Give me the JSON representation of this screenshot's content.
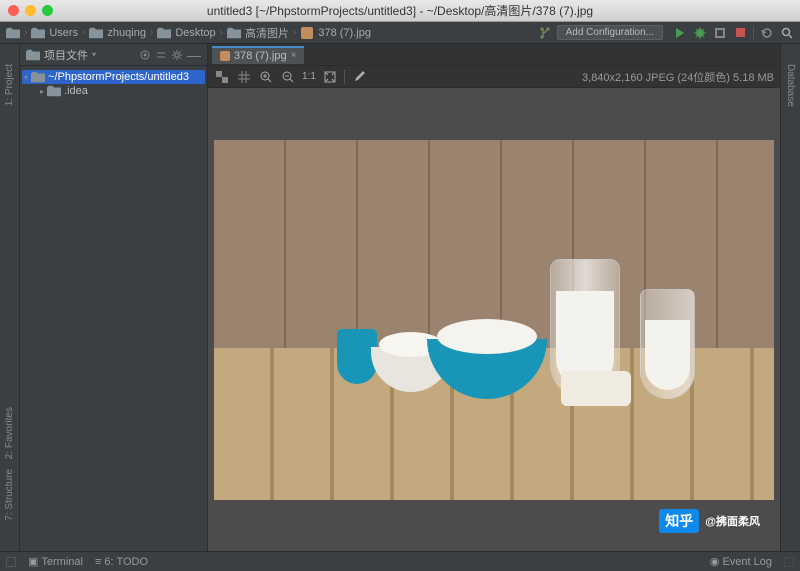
{
  "title": "untitled3 [~/PhpstormProjects/untitled3] - ~/Desktop/高清图片/378 (7).jpg",
  "breadcrumbs": [
    "Users",
    "zhuqing",
    "Desktop",
    "高清图片",
    "378 (7).jpg"
  ],
  "add_config_label": "Add Configuration...",
  "sidebar": {
    "title": "项目文件",
    "root": "~/PhpstormProjects/untitled3",
    "items": [
      ".idea"
    ]
  },
  "tabs": [
    {
      "label": "378 (7).jpg",
      "active": true
    }
  ],
  "image_toolbar": {
    "fit_label": "1:1",
    "info": "3,840x2,160 JPEG (24位颜色) 5.18 MB"
  },
  "left_rail": [
    "1: Project",
    "2: Favorites",
    "7: Structure"
  ],
  "right_rail": [
    "Database"
  ],
  "statusbar": {
    "terminal": "Terminal",
    "todo": "6: TODO",
    "event_log": "Event Log"
  },
  "watermark": {
    "brand": "知乎",
    "handle": "@拂面柔风"
  }
}
